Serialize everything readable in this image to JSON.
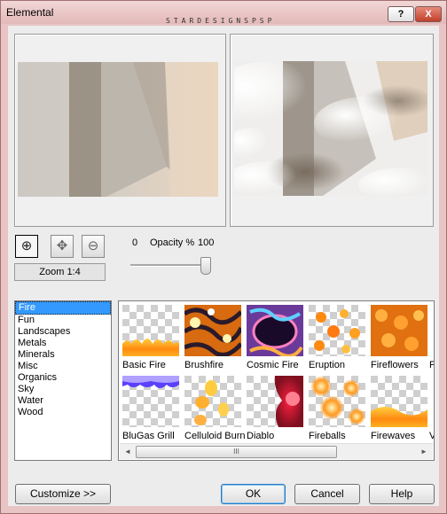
{
  "window": {
    "title": "Elemental",
    "watermark": "STARDESIGNSPSP",
    "help_button": "?",
    "close_button": "X"
  },
  "zoom": {
    "label": "Zoom 1:4"
  },
  "opacity": {
    "min_label": "0",
    "label": "Opacity %",
    "max_label": "100",
    "value": 100
  },
  "categories": {
    "items": [
      "Fire",
      "Fun",
      "Landscapes",
      "Metals",
      "Minerals",
      "Misc",
      "Organics",
      "Sky",
      "Water",
      "Wood"
    ],
    "selected": "Fire"
  },
  "thumbnails": {
    "row1": [
      "Basic Fire",
      "Brushfire",
      "Cosmic Fire",
      "Eruption",
      "Fireflowers",
      "F"
    ],
    "row2": [
      "BluGas Grill",
      "Celluloid Burn",
      "Diablo",
      "Fireballs",
      "Firewaves",
      "V"
    ]
  },
  "scrollbar": {
    "left_icon": "◄",
    "right_icon": "►",
    "grip": "III"
  },
  "buttons": {
    "customize": "Customize  >>",
    "ok": "OK",
    "cancel": "Cancel",
    "help": "Help"
  }
}
